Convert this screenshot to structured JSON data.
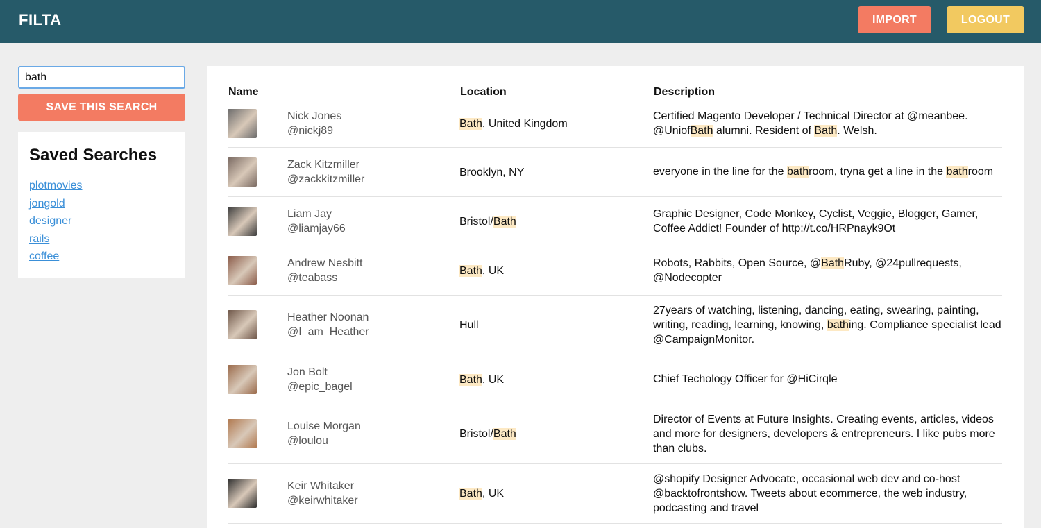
{
  "header": {
    "brand": "FILTA",
    "import_label": "IMPORT",
    "logout_label": "LOGOUT",
    "colors": {
      "bar": "#265a69",
      "import": "#f37b62",
      "logout": "#f2c960"
    }
  },
  "sidebar": {
    "search_value": "bath",
    "save_label": "SAVE THIS SEARCH",
    "saved_title": "Saved Searches",
    "saved": [
      "plotmovies",
      "jongold",
      "designer",
      "rails",
      "coffee"
    ]
  },
  "table": {
    "headers": {
      "name": "Name",
      "location": "Location",
      "description": "Description"
    },
    "highlight_color": "#fde9c4",
    "rows": [
      {
        "name": "Nick Jones",
        "handle": "@nickj89",
        "avatar_color": "#6b6b6b",
        "location": [
          {
            "t": "Bath",
            "hl": true
          },
          {
            "t": ", United Kingdom"
          }
        ],
        "description": [
          {
            "t": "Certified Magento Developer / Technical Director at @meanbee. @Uniof"
          },
          {
            "t": "Bath",
            "hl": true
          },
          {
            "t": " alumni. Resident of "
          },
          {
            "t": "Bath",
            "hl": true
          },
          {
            "t": ". Welsh."
          }
        ]
      },
      {
        "name": "Zack Kitzmiller",
        "handle": "@zackkitzmiller",
        "avatar_color": "#7a6a62",
        "location": [
          {
            "t": "Brooklyn, NY"
          }
        ],
        "description": [
          {
            "t": "everyone in the line for the "
          },
          {
            "t": "bath",
            "hl": true
          },
          {
            "t": "room, tryna get a line in the "
          },
          {
            "t": "bath",
            "hl": true
          },
          {
            "t": "room"
          }
        ]
      },
      {
        "name": "Liam Jay",
        "handle": "@liamjay66",
        "avatar_color": "#3c3c3c",
        "location": [
          {
            "t": "Bristol/"
          },
          {
            "t": "Bath",
            "hl": true
          }
        ],
        "description": [
          {
            "t": "Graphic Designer, Code Monkey, Cyclist, Veggie, Blogger, Gamer, Coffee Addict! Founder of http://t.co/HRPnayk9Ot"
          }
        ]
      },
      {
        "name": "Andrew Nesbitt",
        "handle": "@teabass",
        "avatar_color": "#8a5a48",
        "location": [
          {
            "t": "Bath",
            "hl": true
          },
          {
            "t": ", UK"
          }
        ],
        "description": [
          {
            "t": "Robots, Rabbits, Open Source, @"
          },
          {
            "t": "Bath",
            "hl": true
          },
          {
            "t": "Ruby, @24pullrequests, @Nodecopter"
          }
        ]
      },
      {
        "name": "Heather Noonan",
        "handle": "@I_am_Heather",
        "avatar_color": "#6e5648",
        "location": [
          {
            "t": "Hull"
          }
        ],
        "description": [
          {
            "t": "27years of watching, listening, dancing, eating, swearing, painting, writing, reading, learning, knowing, "
          },
          {
            "t": "bath",
            "hl": true
          },
          {
            "t": "ing. Compliance specialist lead @CampaignMonitor."
          }
        ]
      },
      {
        "name": "Jon Bolt",
        "handle": "@epic_bagel",
        "avatar_color": "#9a6a4a",
        "location": [
          {
            "t": "Bath",
            "hl": true
          },
          {
            "t": ", UK"
          }
        ],
        "description": [
          {
            "t": "Chief Techology Officer for @HiCirqle"
          }
        ]
      },
      {
        "name": "Louise Morgan",
        "handle": "@loulou",
        "avatar_color": "#b0784e",
        "location": [
          {
            "t": "Bristol/"
          },
          {
            "t": "Bath",
            "hl": true
          }
        ],
        "description": [
          {
            "t": "Director of Events at Future Insights. Creating events, articles, videos and more for designers, developers & entrepreneurs. I like pubs more than clubs."
          }
        ]
      },
      {
        "name": "Keir Whitaker",
        "handle": "@keirwhitaker",
        "avatar_color": "#2e2e2e",
        "location": [
          {
            "t": "Bath",
            "hl": true
          },
          {
            "t": ", UK"
          }
        ],
        "description": [
          {
            "t": "@shopify Designer Advocate, occasional web dev and co-host @backtofrontshow. Tweets about ecommerce, the web industry, podcasting and travel"
          }
        ]
      }
    ]
  }
}
